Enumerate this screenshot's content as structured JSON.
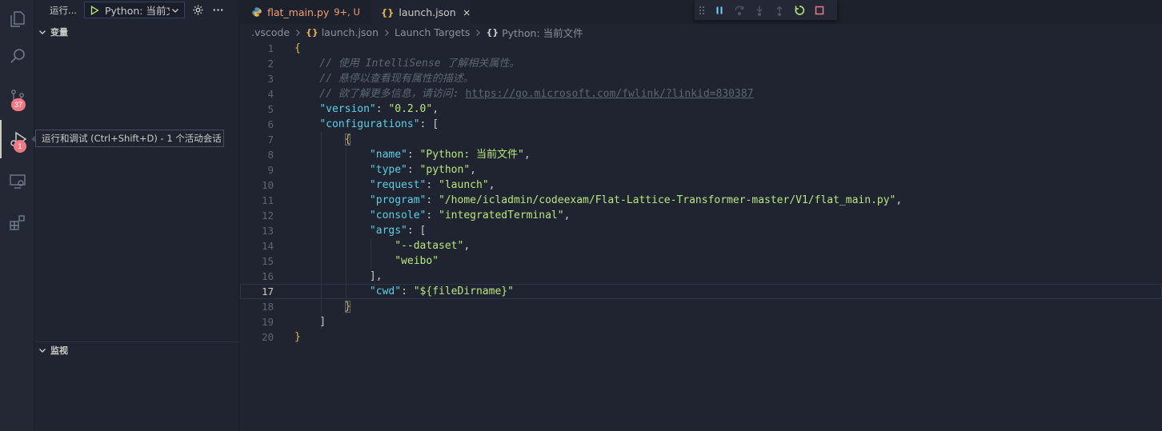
{
  "activity_bar": {
    "items": [
      {
        "name": "explorer",
        "icon": "files-icon"
      },
      {
        "name": "search",
        "icon": "search-icon"
      },
      {
        "name": "source-control",
        "icon": "source-control-icon",
        "badge": "37"
      },
      {
        "name": "run-debug",
        "icon": "run-debug-icon",
        "badge": "1"
      },
      {
        "name": "remote-explorer",
        "icon": "remote-explorer-icon"
      },
      {
        "name": "extensions",
        "icon": "extensions-icon"
      }
    ]
  },
  "sidebar": {
    "run_label": "运行...",
    "config_selected": "Python: 当前文",
    "variables_title": "变量",
    "watch_title": "监视"
  },
  "tooltip": {
    "text": "运行和调试 (Ctrl+Shift+D) - 1 个活动会话"
  },
  "tabs": [
    {
      "label": "flat_main.py",
      "modified": "9+, U"
    },
    {
      "label": "launch.json"
    }
  ],
  "breadcrumb": {
    "items": [
      ".vscode",
      "launch.json",
      "Launch Targets",
      "Python: 当前文件"
    ]
  },
  "editor": {
    "lines": [
      {
        "n": "1",
        "text": "{"
      },
      {
        "n": "2",
        "text": "    // 使用 IntelliSense 了解相关属性。"
      },
      {
        "n": "3",
        "text": "    // 悬停以查看现有属性的描述。"
      },
      {
        "n": "4",
        "text_prefix": "    // 欲了解更多信息，请访问: ",
        "link": "https://go.microsoft.com/fwlink/?linkid=830387"
      },
      {
        "n": "5",
        "key": "\"version\"",
        "value": "\"0.2.0\"",
        "indent": "    ",
        "trail": ","
      },
      {
        "n": "6",
        "key": "\"configurations\"",
        "value": "[",
        "indent": "    ",
        "trail": ""
      },
      {
        "n": "7",
        "text": "        {"
      },
      {
        "n": "8",
        "key": "\"name\"",
        "value": "\"Python: 当前文件\"",
        "indent": "            ",
        "trail": ","
      },
      {
        "n": "9",
        "key": "\"type\"",
        "value": "\"python\"",
        "indent": "            ",
        "trail": ","
      },
      {
        "n": "10",
        "key": "\"request\"",
        "value": "\"launch\"",
        "indent": "            ",
        "trail": ","
      },
      {
        "n": "11",
        "key": "\"program\"",
        "value": "\"/home/icladmin/codeexam/Flat-Lattice-Transformer-master/V1/flat_main.py\"",
        "indent": "            ",
        "trail": ","
      },
      {
        "n": "12",
        "key": "\"console\"",
        "value": "\"integratedTerminal\"",
        "indent": "            ",
        "trail": ","
      },
      {
        "n": "13",
        "key": "\"args\"",
        "value": "[",
        "indent": "            ",
        "trail": ""
      },
      {
        "n": "14",
        "value": "\"--dataset\"",
        "indent": "                ",
        "trail": ","
      },
      {
        "n": "15",
        "value": "\"weibo\"",
        "indent": "                ",
        "trail": ""
      },
      {
        "n": "16",
        "text": "            ],"
      },
      {
        "n": "17",
        "key": "\"cwd\"",
        "value": "\"${fileDirname}\"",
        "indent": "            ",
        "trail": ""
      },
      {
        "n": "18",
        "text": "        }"
      },
      {
        "n": "19",
        "text": "    ]"
      },
      {
        "n": "20",
        "text": "}"
      }
    ],
    "current_line": "17"
  },
  "colors": {
    "background": "#1f2430",
    "accent": "#e6b450",
    "key": "#5ccfe6",
    "string": "#bae67e",
    "badge": "#f27983",
    "modified_tab": "#f29e74"
  }
}
